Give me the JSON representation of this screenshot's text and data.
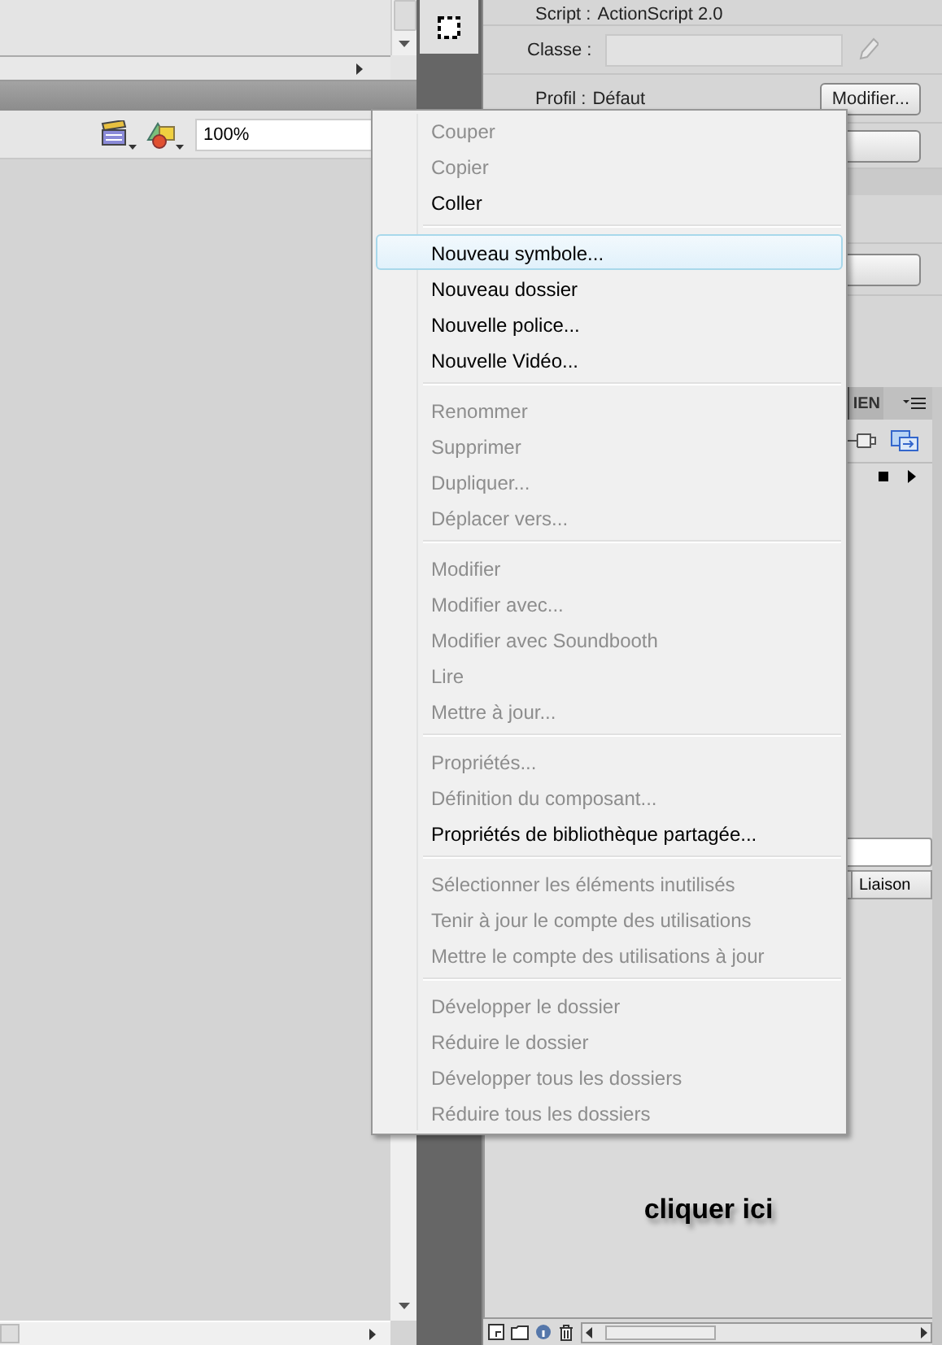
{
  "stage_panel": {
    "zoom_field": {
      "value": "100%"
    }
  },
  "properties": {
    "script_row": {
      "label": "Script :",
      "value": "ActionScript 2.0"
    },
    "class_row": {
      "label": "Classe :"
    },
    "profile_row": {
      "label": "Profil :",
      "value": "Défaut",
      "button": "Modifier..."
    }
  },
  "library": {
    "tab": "IEN",
    "columns": [
      "Liaison"
    ]
  },
  "annotation": "cliquer ici",
  "context_menu": {
    "groups": [
      [
        {
          "label": "Couper",
          "disabled": true,
          "selected": false
        },
        {
          "label": "Copier",
          "disabled": true,
          "selected": false
        },
        {
          "label": "Coller",
          "disabled": false,
          "selected": false
        }
      ],
      [
        {
          "label": "Nouveau symbole...",
          "disabled": false,
          "selected": true
        },
        {
          "label": "Nouveau dossier",
          "disabled": false,
          "selected": false
        },
        {
          "label": "Nouvelle police...",
          "disabled": false,
          "selected": false
        },
        {
          "label": "Nouvelle Vidéo...",
          "disabled": false,
          "selected": false
        }
      ],
      [
        {
          "label": "Renommer",
          "disabled": true,
          "selected": false
        },
        {
          "label": "Supprimer",
          "disabled": true,
          "selected": false
        },
        {
          "label": "Dupliquer...",
          "disabled": true,
          "selected": false
        },
        {
          "label": "Déplacer vers...",
          "disabled": true,
          "selected": false
        }
      ],
      [
        {
          "label": "Modifier",
          "disabled": true,
          "selected": false
        },
        {
          "label": "Modifier avec...",
          "disabled": true,
          "selected": false
        },
        {
          "label": "Modifier avec Soundbooth",
          "disabled": true,
          "selected": false
        },
        {
          "label": "Lire",
          "disabled": true,
          "selected": false
        },
        {
          "label": "Mettre à jour...",
          "disabled": true,
          "selected": false
        }
      ],
      [
        {
          "label": "Propriétés...",
          "disabled": true,
          "selected": false
        },
        {
          "label": "Définition du composant...",
          "disabled": true,
          "selected": false
        },
        {
          "label": "Propriétés de bibliothèque partagée...",
          "disabled": false,
          "selected": false
        }
      ],
      [
        {
          "label": "Sélectionner les éléments inutilisés",
          "disabled": true,
          "selected": false
        },
        {
          "label": "Tenir à jour le compte des utilisations",
          "disabled": true,
          "selected": false
        },
        {
          "label": "Mettre le compte des utilisations à jour",
          "disabled": true,
          "selected": false
        }
      ],
      [
        {
          "label": "Développer le dossier",
          "disabled": true,
          "selected": false
        },
        {
          "label": "Réduire le dossier",
          "disabled": true,
          "selected": false
        },
        {
          "label": "Développer tous les dossiers",
          "disabled": true,
          "selected": false
        },
        {
          "label": "Réduire tous les dossiers",
          "disabled": true,
          "selected": false
        }
      ]
    ]
  }
}
